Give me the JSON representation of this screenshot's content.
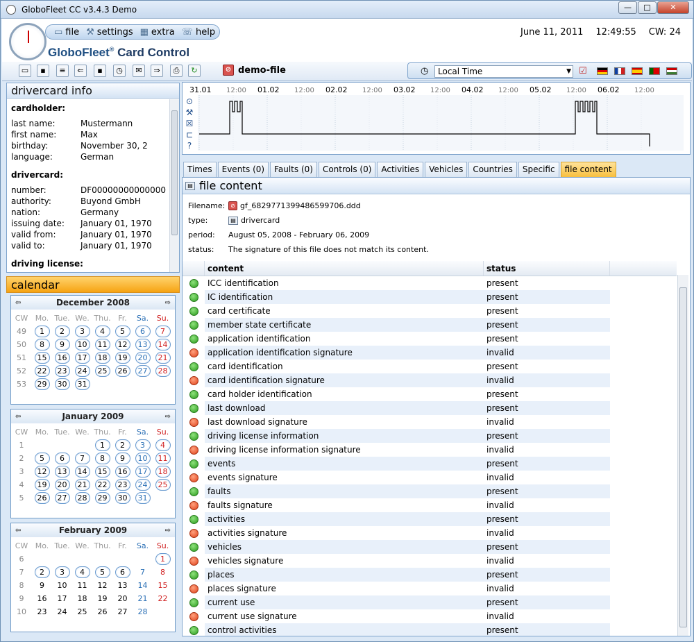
{
  "window": {
    "title": "GloboFleet CC v3.4.3 Demo",
    "buttons": [
      "—",
      "□",
      "✕"
    ]
  },
  "menu": {
    "items": [
      {
        "label": "file",
        "icon": "folder-icon"
      },
      {
        "label": "settings",
        "icon": "wrench-icon"
      },
      {
        "label": "extra",
        "icon": "grid-icon"
      },
      {
        "label": "help",
        "icon": "help-icon"
      }
    ]
  },
  "brand": {
    "name": "GloboFleet",
    "product": "Card Control"
  },
  "status": {
    "date": "June 11, 2011",
    "time": "12:49:55",
    "cw": "CW: 24"
  },
  "toolbar": {
    "file_label": "demo-file",
    "timezone": "Local Time"
  },
  "driver_info": {
    "title": "drivercard info",
    "cardholder_title": "cardholder:",
    "cardholder": [
      [
        "last name:",
        "Mustermann"
      ],
      [
        "first name:",
        "Max"
      ],
      [
        "birthday:",
        "November 30, 2"
      ],
      [
        "language:",
        "German"
      ]
    ],
    "drivercard_title": "drivercard:",
    "drivercard": [
      [
        "number:",
        "DF00000000000000"
      ],
      [
        "authority:",
        "Buyond GmbH"
      ],
      [
        "nation:",
        "Germany"
      ],
      [
        "issuing date:",
        "January 01, 1970"
      ],
      [
        "valid from:",
        "January 01, 1970"
      ],
      [
        "valid to:",
        "January 01, 1970"
      ]
    ],
    "license_title": "driving license:"
  },
  "calendar": {
    "title": "calendar",
    "weekdays": [
      "CW",
      "Mo.",
      "Tue.",
      "We.",
      "Thu.",
      "Fr.",
      "Sa.",
      "Su."
    ],
    "months": [
      {
        "name": "December 2008",
        "weeks": [
          [
            "49",
            "1",
            "2",
            "3",
            "4",
            "5",
            "6",
            "7"
          ],
          [
            "50",
            "8",
            "9",
            "10",
            "11",
            "12",
            "13",
            "14"
          ],
          [
            "51",
            "15",
            "16",
            "17",
            "18",
            "19",
            "20",
            "21"
          ],
          [
            "52",
            "22",
            "23",
            "24",
            "25",
            "26",
            "27",
            "28"
          ],
          [
            "53",
            "29",
            "30",
            "31",
            "",
            "",
            "",
            ""
          ]
        ]
      },
      {
        "name": "January 2009",
        "weeks": [
          [
            "1",
            "",
            "",
            "",
            "1",
            "2",
            "3",
            "4"
          ],
          [
            "2",
            "5",
            "6",
            "7",
            "8",
            "9",
            "10",
            "11"
          ],
          [
            "3",
            "12",
            "13",
            "14",
            "15",
            "16",
            "17",
            "18"
          ],
          [
            "4",
            "19",
            "20",
            "21",
            "22",
            "23",
            "24",
            "25"
          ],
          [
            "5",
            "26",
            "27",
            "28",
            "29",
            "30",
            "31",
            ""
          ]
        ]
      },
      {
        "name": "February 2009",
        "weeks": [
          [
            "6",
            "",
            "",
            "",
            "",
            "",
            "",
            "1"
          ],
          [
            "7",
            "2",
            "3",
            "4",
            "5",
            "6",
            "7",
            "8"
          ],
          [
            "8",
            "9",
            "10",
            "11",
            "12",
            "13",
            "14",
            "15"
          ],
          [
            "9",
            "16",
            "17",
            "18",
            "19",
            "20",
            "21",
            "22"
          ],
          [
            "10",
            "23",
            "24",
            "25",
            "26",
            "27",
            "28",
            ""
          ]
        ]
      }
    ]
  },
  "timeline": {
    "labels": [
      "31.01",
      "12:00",
      "01.02",
      "12:00",
      "02.02",
      "12:00",
      "03.02",
      "12:00",
      "04.02",
      "12:00",
      "05.02",
      "12:00",
      "06.02",
      "12:00"
    ],
    "icons": [
      "circle-target-icon",
      "tools-icon",
      "box-icon",
      "bed-icon",
      "question-icon"
    ]
  },
  "tabs": [
    "Times",
    "Events (0)",
    "Faults (0)",
    "Controls (0)",
    "Activities",
    "Vehicles",
    "Countries",
    "Specific",
    "file content"
  ],
  "file_content": {
    "title": "file content",
    "filename_label": "Filename:",
    "filename": "gf_6829771399486599706.ddd",
    "type_label": "type:",
    "type": "drivercard",
    "period_label": "period:",
    "period": "August 05, 2008 - February 06, 2009",
    "status_label": "status:",
    "status": "The signature of this file does not match its content."
  },
  "table": {
    "headers": [
      "content",
      "status"
    ],
    "rows": [
      [
        "ICC identification",
        "present"
      ],
      [
        "IC identification",
        "present"
      ],
      [
        "card certificate",
        "present"
      ],
      [
        "member state certificate",
        "present"
      ],
      [
        "application identification",
        "present"
      ],
      [
        "application identification signature",
        "invalid"
      ],
      [
        "card identification",
        "present"
      ],
      [
        "card identification signature",
        "invalid"
      ],
      [
        "card holder identification",
        "present"
      ],
      [
        "last download",
        "present"
      ],
      [
        "last download signature",
        "invalid"
      ],
      [
        "driving license information",
        "present"
      ],
      [
        "driving license information signature",
        "invalid"
      ],
      [
        "events",
        "present"
      ],
      [
        "events signature",
        "invalid"
      ],
      [
        "faults",
        "present"
      ],
      [
        "faults signature",
        "invalid"
      ],
      [
        "activities",
        "present"
      ],
      [
        "activities signature",
        "invalid"
      ],
      [
        "vehicles",
        "present"
      ],
      [
        "vehicles signature",
        "invalid"
      ],
      [
        "places",
        "present"
      ],
      [
        "places signature",
        "invalid"
      ],
      [
        "current use",
        "present"
      ],
      [
        "current use signature",
        "invalid"
      ],
      [
        "control activities",
        "present"
      ]
    ]
  }
}
